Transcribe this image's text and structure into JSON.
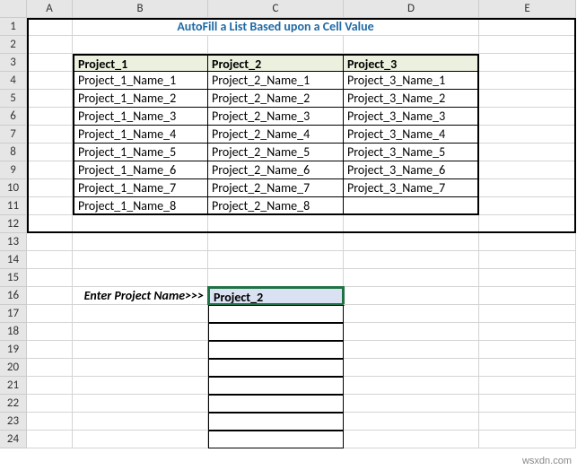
{
  "columns": [
    "A",
    "B",
    "C",
    "D",
    "E"
  ],
  "rows": [
    "1",
    "2",
    "3",
    "4",
    "5",
    "6",
    "7",
    "8",
    "9",
    "10",
    "11",
    "12",
    "13",
    "14",
    "15",
    "16",
    "17",
    "18",
    "19",
    "20",
    "21",
    "22",
    "23",
    "24"
  ],
  "title": "AutoFill a List Based upon a Cell Value",
  "table": {
    "headers": [
      "Project_1",
      "Project_2",
      "Project_3"
    ],
    "rows": [
      [
        "Project_1_Name_1",
        "Project_2_Name_1",
        "Project_3_Name_1"
      ],
      [
        "Project_1_Name_2",
        "Project_2_Name_2",
        "Project_3_Name_2"
      ],
      [
        "Project_1_Name_3",
        "Project_2_Name_3",
        "Project_3_Name_3"
      ],
      [
        "Project_1_Name_4",
        "Project_2_Name_4",
        "Project_3_Name_4"
      ],
      [
        "Project_1_Name_5",
        "Project_2_Name_5",
        "Project_3_Name_5"
      ],
      [
        "Project_1_Name_6",
        "Project_2_Name_6",
        "Project_3_Name_6"
      ],
      [
        "Project_1_Name_7",
        "Project_2_Name_7",
        "Project_3_Name_7"
      ],
      [
        "Project_1_Name_8",
        "Project_2_Name_8",
        ""
      ]
    ]
  },
  "input": {
    "label": "Enter Project Name>>>",
    "value": "Project_2"
  },
  "watermark": "wsxdn.com"
}
